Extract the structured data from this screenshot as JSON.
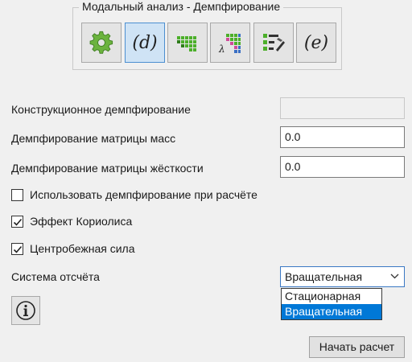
{
  "toolbar": {
    "title": "Модальный анализ - Демпфирование",
    "buttons": [
      {
        "icon": "gear-icon"
      },
      {
        "icon": "d-variable-icon",
        "text": "(d)",
        "active": true
      },
      {
        "icon": "matrix-grid-icon"
      },
      {
        "icon": "lambda-matrix-icon",
        "text": "λ"
      },
      {
        "icon": "list-edit-icon"
      },
      {
        "icon": "e-variable-icon",
        "text": "(e)"
      }
    ]
  },
  "form": {
    "structural_damping": {
      "label": "Конструкционное демпфирование",
      "value": ""
    },
    "mass_damping": {
      "label": "Демпфирование матрицы масс",
      "value": "0.0"
    },
    "stiffness_damping": {
      "label": "Демпфирование матрицы жёсткости",
      "value": "0.0"
    },
    "use_damping": {
      "label": "Использовать демпфирование при расчёте",
      "checked": false
    },
    "coriolis": {
      "label": "Эффект Кориолиса",
      "checked": true
    },
    "centrifugal": {
      "label": "Центробежная сила",
      "checked": true
    },
    "reference_system": {
      "label": "Система отсчёта",
      "selected": "Вращательная",
      "options": [
        "Стационарная",
        "Вращательная"
      ],
      "highlighted_option": "Вращательная"
    }
  },
  "info_button": {
    "icon": "info-icon"
  },
  "run_button": {
    "label": "Начать расчет"
  },
  "colors": {
    "accent": "#0078d7",
    "gear": "#6bb33e",
    "matrix_green": "#4caf2a"
  }
}
